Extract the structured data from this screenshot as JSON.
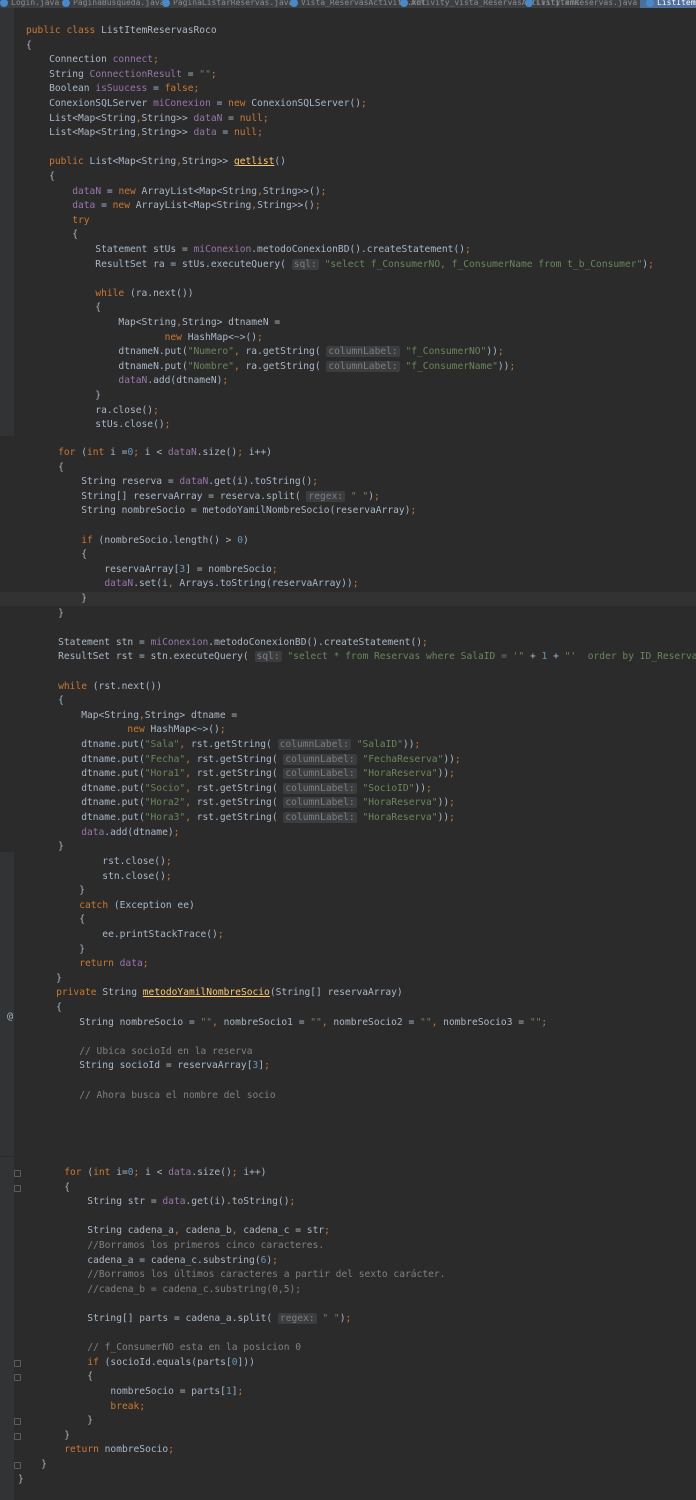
{
  "tabs": [
    {
      "label": "Login.java"
    },
    {
      "label": "PaginaBusqueda.java"
    },
    {
      "label": "PaginaListarReservas.java"
    },
    {
      "label": "Vista_ReservasActivity.xml"
    },
    {
      "label": "Activity_vista_ReservasActivity.xml"
    },
    {
      "label": "ListItemReservas.java"
    },
    {
      "label": "ListItemMen..."
    }
  ],
  "code": {
    "panel1": [
      "public class ListItemReservasRoco",
      "{",
      "    Connection connect;",
      "    String ConnectionResult = \"\";",
      "    Boolean isSuucess = false;",
      "    ConexionSQLServer miConexion = new ConexionSQLServer();",
      "    List<Map<String,String>> dataN = null;",
      "    List<Map<String,String>> data = null;",
      "",
      "    public List<Map<String,String>> getlist()",
      "    {",
      "        dataN = new ArrayList<Map<String,String>>();",
      "        data = new ArrayList<Map<String,String>>();",
      "        try",
      "        {",
      "            Statement stUs = miConexion.metodoConexionBD().createStatement();",
      "            ResultSet ra = stUs.executeQuery( sql: \"select f_ConsumerNO, f_ConsumerName from t_b_Consumer\");",
      "",
      "            while (ra.next())",
      "            {",
      "                Map<String,String> dtnameN =",
      "                        new HashMap<~>();",
      "                dtnameN.put(\"Numero\", ra.getString( columnLabel: \"f_ConsumerNO\"));",
      "                dtnameN.put(\"Nombre\", ra.getString( columnLabel: \"f_ConsumerName\"));",
      "                dataN.add(dtnameN);",
      "            }",
      "            ra.close();",
      "            stUs.close();"
    ],
    "panel2": [
      "    for (int i =0; i < dataN.size(); i++)",
      "    {",
      "        String reserva = dataN.get(i).toString();",
      "        String[] reservaArray = reserva.split( regex: \" \");",
      "        String nombreSocio = metodoYamilNombreSocio(reservaArray);",
      "",
      "        if (nombreSocio.length() > 0)",
      "        {",
      "            reservaArray[3] = nombreSocio;",
      "            dataN.set(i, Arrays.toString(reservaArray));",
      "        }",
      "    }",
      "",
      "    Statement stn = miConexion.metodoConexionBD().createStatement();",
      "    ResultSet rst = stn.executeQuery( sql: \"select * from Reservas where SalaID = '\" + 1 + \"'  order by ID_Reserva Desc\");",
      "",
      "    while (rst.next())",
      "    {",
      "        Map<String,String> dtname =",
      "                new HashMap<~>();",
      "        dtname.put(\"Sala\", rst.getString( columnLabel: \"SalaID\"));",
      "        dtname.put(\"Fecha\", rst.getString( columnLabel: \"FechaReserva\"));",
      "        dtname.put(\"Hora1\", rst.getString( columnLabel: \"HoraReserva\"));",
      "        dtname.put(\"Socio\", rst.getString( columnLabel: \"SocioID\"));",
      "        dtname.put(\"Hora2\", rst.getString( columnLabel: \"HoraReserva\"));",
      "        dtname.put(\"Hora3\", rst.getString( columnLabel: \"HoraReserva\"));",
      "        data.add(dtname);",
      "    }"
    ],
    "panel3": [
      "            rst.close();",
      "            stn.close();",
      "        }",
      "        catch (Exception ee)",
      "        {",
      "            ee.printStackTrace();",
      "        }",
      "        return data;",
      "    }",
      "    private String metodoYamilNombreSocio(String[] reservaArray)",
      "    {",
      "        String nombreSocio = \"\", nombreSocio1 = \"\", nombreSocio2 = \"\", nombreSocio3 = \"\";",
      "",
      "        // Ubica socioId en la reserva",
      "        String socioId = reservaArray[3];",
      "",
      "        // Ahora busca el nombre del socio"
    ],
    "panel4": [
      "        for (int i=0; i < data.size(); i++)",
      "        {",
      "            String str = data.get(i).toString();",
      "",
      "            String cadena_a, cadena_b, cadena_c = str;",
      "            //Borramos los primeros cinco caracteres.",
      "            cadena_a = cadena_c.substring(6);",
      "            //Borramos los últimos caracteres a partir del sexto carácter.",
      "            //cadena_b = cadena_c.substring(0,5);",
      "",
      "            String[] parts = cadena_a.split( regex: \" \");",
      "",
      "            // f_ConsumerNO esta en la posicion 0",
      "            if (socioId.equals(parts[0]))",
      "            {",
      "                nombreSocio = parts[1];",
      "                break;",
      "            }",
      "        }",
      "        return nombreSocio;",
      "    }",
      "}"
    ]
  },
  "gutter": {
    "override_marker": "@"
  },
  "colors": {
    "background": "#2b2b2b",
    "keyword": "#cc7832",
    "string": "#6a8759",
    "field": "#9876aa",
    "number": "#6897bb",
    "method": "#ffc66d",
    "comment": "#808080",
    "text": "#a9b7c6"
  }
}
